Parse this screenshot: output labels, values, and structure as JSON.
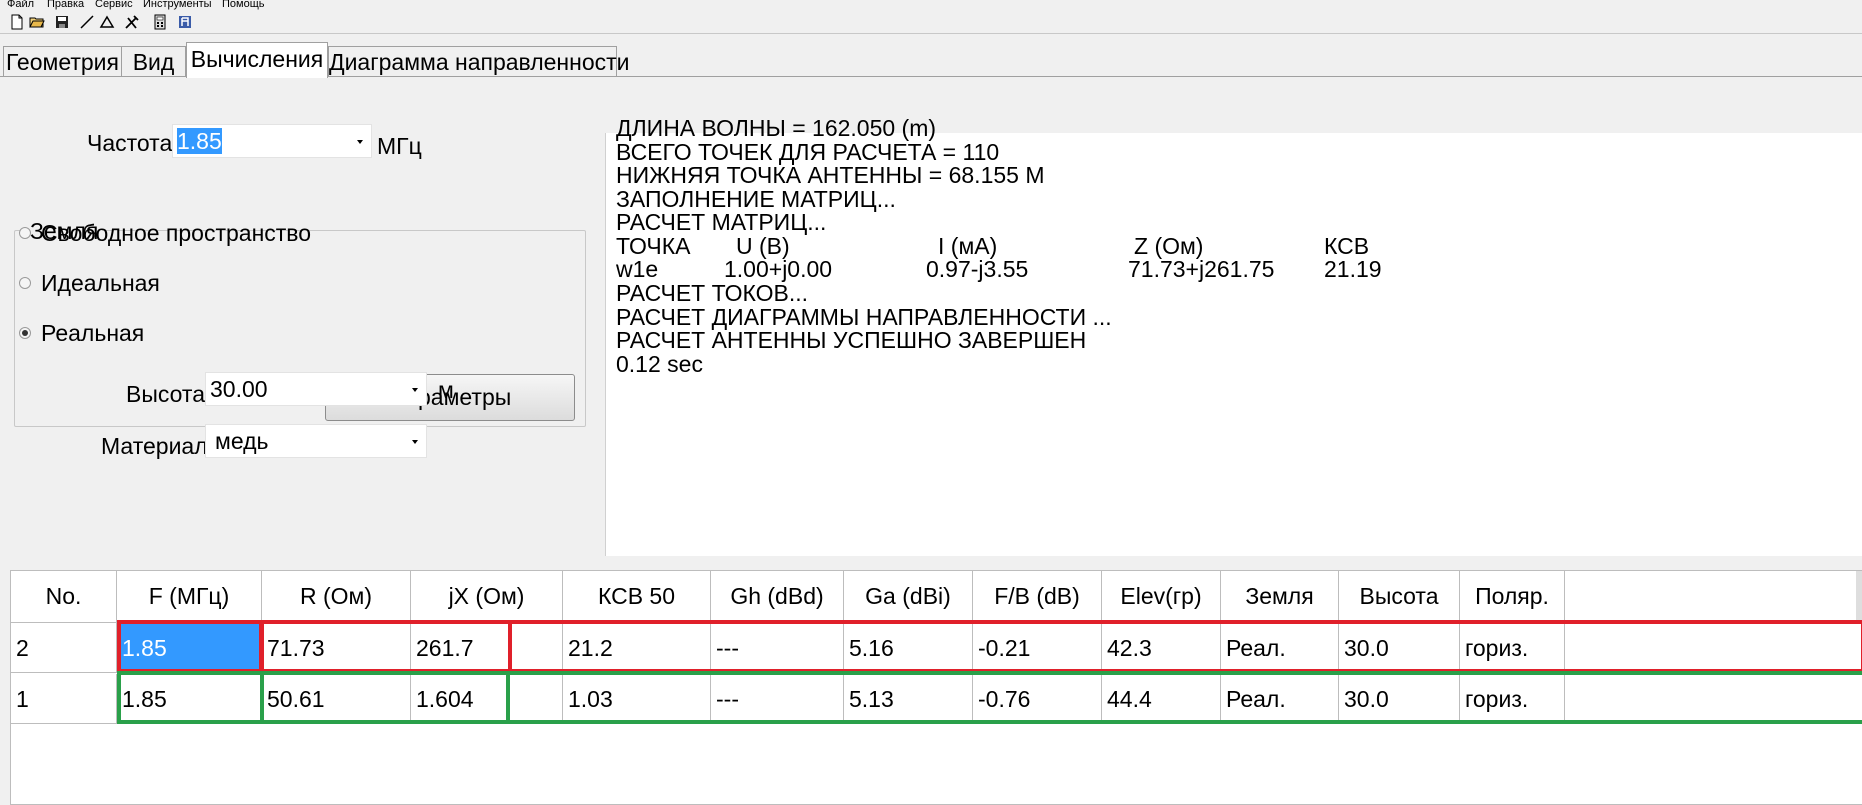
{
  "menu": [
    "Файл",
    "Правка",
    "Сервис",
    "Инструменты",
    "Помощь"
  ],
  "toolbar": [
    "new-file-icon",
    "open-folder-icon",
    "save-icon",
    "line-icon",
    "triangle-icon",
    "tools-icon",
    "calculator-icon",
    "antenna-icon"
  ],
  "tabs": [
    "Геометрия",
    "Вид",
    "Вычисления",
    "Диаграмма направленности"
  ],
  "active_tab": "Вычисления",
  "frequency": {
    "label": "Частота",
    "value": "1.85",
    "unit": "МГц"
  },
  "ground": {
    "title": "Земля",
    "options": [
      "Свободное пространство",
      "Идеальная",
      "Реальная"
    ],
    "selected": "Реальная",
    "params_button": "Параметры"
  },
  "height": {
    "label": "Высота",
    "value": "30.00",
    "unit": "м"
  },
  "material": {
    "label": "Материал",
    "value": "медь"
  },
  "output": {
    "lines": [
      "ДЛИНА ВОЛНЫ = 162.050 (m)",
      "ВСЕГО ТОЧЕК ДЛЯ РАСЧЕТА = 110",
      "НИЖНЯЯ ТОЧКА АНТЕННЫ = 68.155 M",
      "ЗАПОЛНЕНИЕ МАТРИЦ...",
      "РАСЧЕТ МАТРИЦ..."
    ],
    "table_header": [
      "ТОЧКА",
      "U (B)",
      "I (мА)",
      "Z (Ом)",
      "КСВ"
    ],
    "table_row": [
      "w1e",
      "1.00+j0.00",
      "0.97-j3.55",
      "71.73+j261.75",
      "21.19"
    ],
    "lines_after": [
      "РАСЧЕТ ТОКОВ...",
      "РАСЧЕТ ДИАГРАММЫ НАПРАВЛЕННОСТИ ...",
      "РАСЧЕТ АНТЕННЫ УСПЕШНО ЗАВЕРШЕН",
      "0.12 sec"
    ]
  },
  "results": {
    "columns": [
      "No.",
      "F (МГц)",
      "R (Ом)",
      "jX (Ом)",
      "КСВ 50",
      "Gh (dBd)",
      "Ga (dBi)",
      "F/B (dB)",
      "Elev(гр)",
      "Земля",
      "Высота",
      "Поляр."
    ],
    "rows": [
      [
        "2",
        "1.85",
        "71.73",
        "261.7",
        "21.2",
        "---",
        "5.16",
        "-0.21",
        "42.3",
        "Реал.",
        "30.0",
        "гориз."
      ],
      [
        "1",
        "1.85",
        "50.61",
        "1.604",
        "1.03",
        "---",
        "5.13",
        "-0.76",
        "44.4",
        "Реал.",
        "30.0",
        "гориз."
      ]
    ]
  },
  "colors": {
    "selection": "#3399ff",
    "highlight_red": "#e0202a",
    "highlight_green": "#2aa04a"
  }
}
